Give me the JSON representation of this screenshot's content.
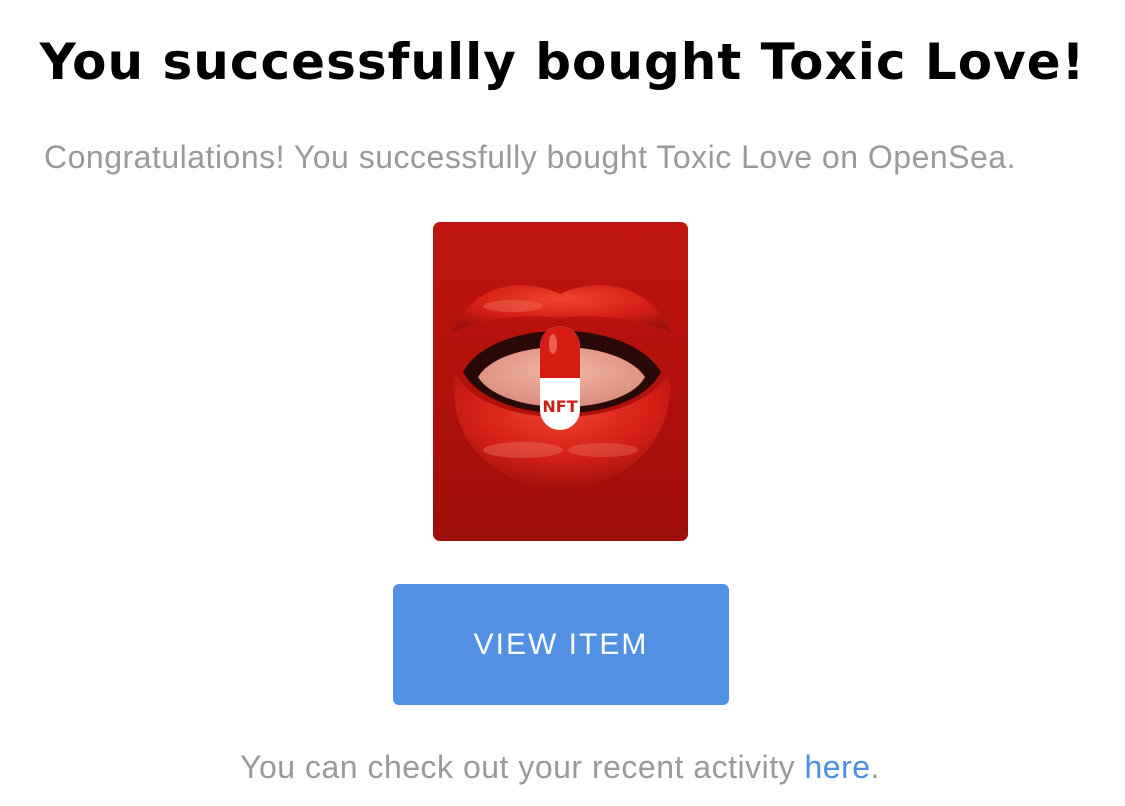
{
  "email": {
    "title": "You successfully bought Toxic Love!",
    "subtitle": "Congratulations! You successfully bought Toxic Love on OpenSea.",
    "item_image": {
      "pill_text": "NFT"
    },
    "view_button_label": "VIEW ITEM",
    "footer": {
      "prefix": "You can check out your recent activity ",
      "link_text": "here",
      "suffix": "."
    }
  },
  "colors": {
    "button": "#5190e3",
    "link": "#4a8fe2",
    "muted_text": "#9a9a9a",
    "title_text": "#000000"
  }
}
